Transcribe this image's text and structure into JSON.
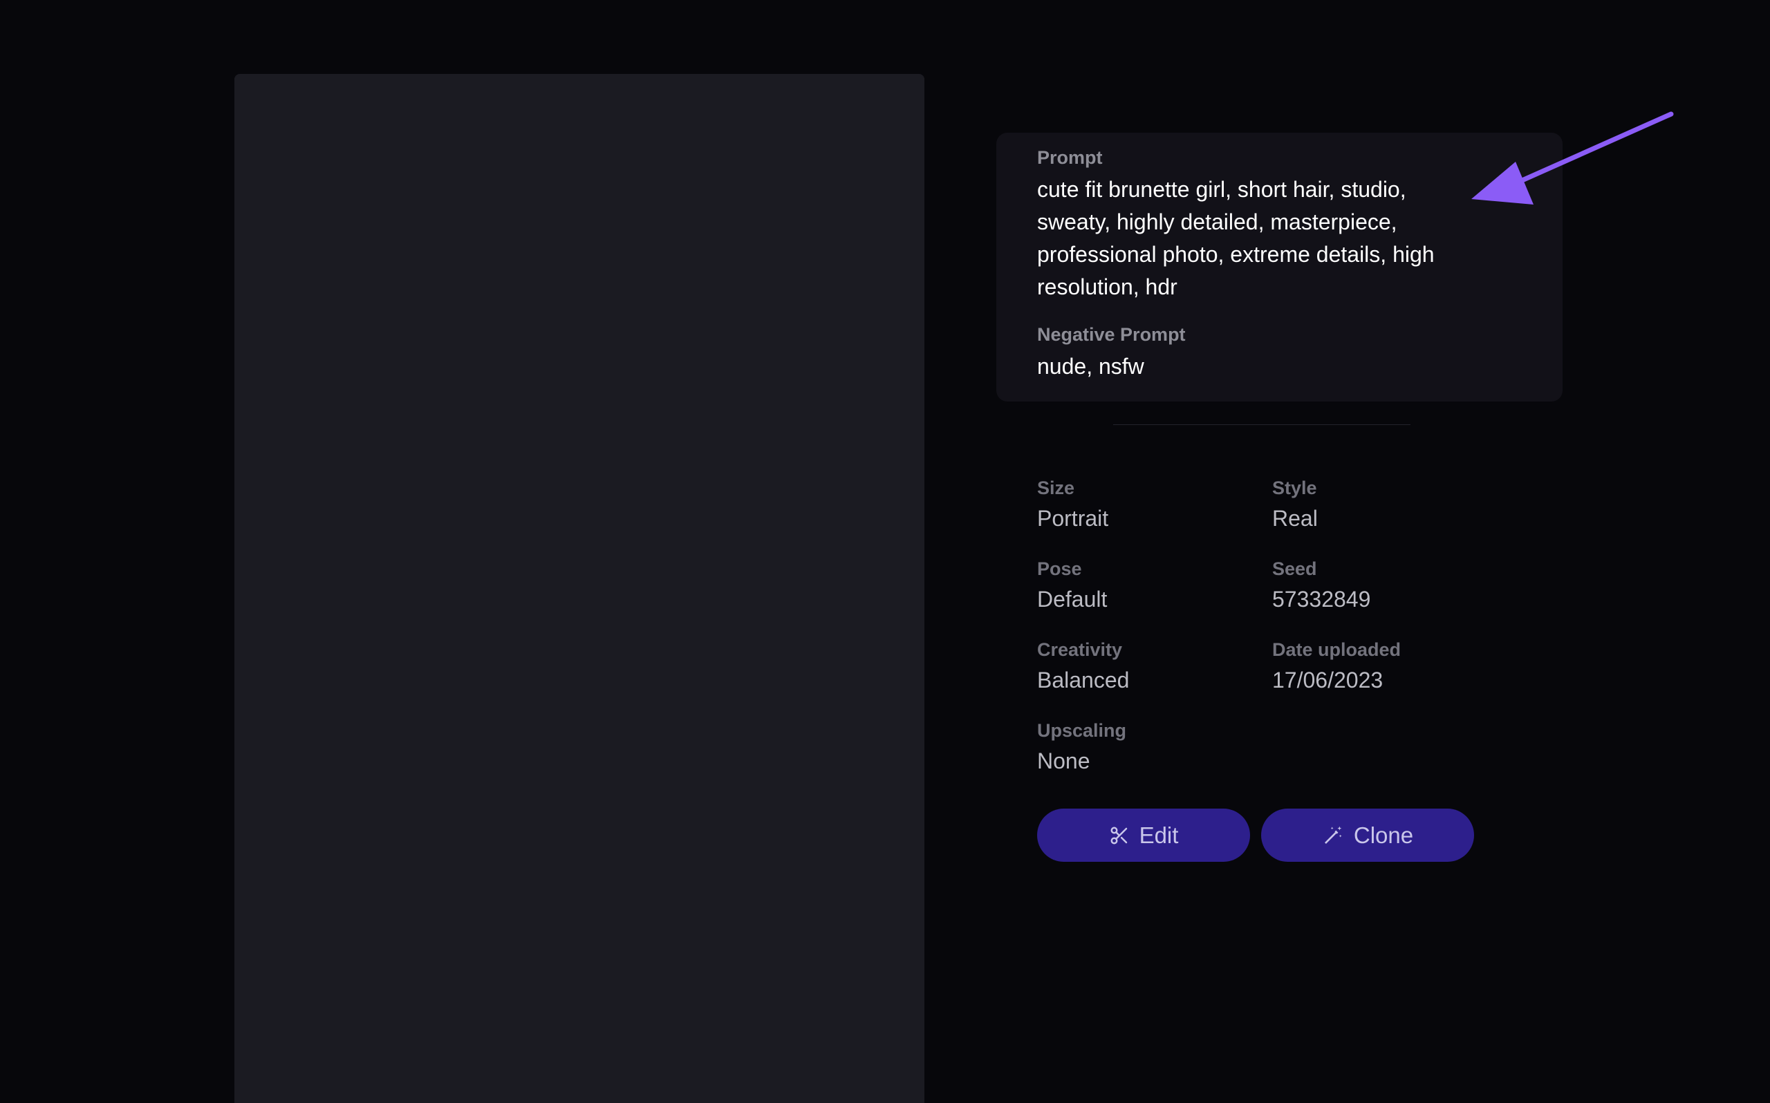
{
  "image_alt": "",
  "prompt": {
    "label": "Prompt",
    "text": "cute fit brunette girl, short hair, studio, sweaty, highly detailed, masterpiece, professional photo, extreme details, high resolution, hdr",
    "negative_label": "Negative Prompt",
    "negative_text": "nude, nsfw"
  },
  "meta": {
    "size": {
      "label": "Size",
      "value": "Portrait"
    },
    "style": {
      "label": "Style",
      "value": "Real"
    },
    "pose": {
      "label": "Pose",
      "value": "Default"
    },
    "seed": {
      "label": "Seed",
      "value": "57332849"
    },
    "creativity": {
      "label": "Creativity",
      "value": "Balanced"
    },
    "date_uploaded": {
      "label": "Date uploaded",
      "value": "17/06/2023"
    },
    "upscaling": {
      "label": "Upscaling",
      "value": "None"
    }
  },
  "buttons": {
    "edit_label": "Edit",
    "edit_icon": "scissors-icon",
    "clone_label": "Clone",
    "clone_icon": "magic-wand-icon"
  },
  "colors": {
    "background": "#07070b",
    "card": "#121118",
    "button": "#2d1f8c",
    "annotation_arrow": "#8b5cf6"
  }
}
